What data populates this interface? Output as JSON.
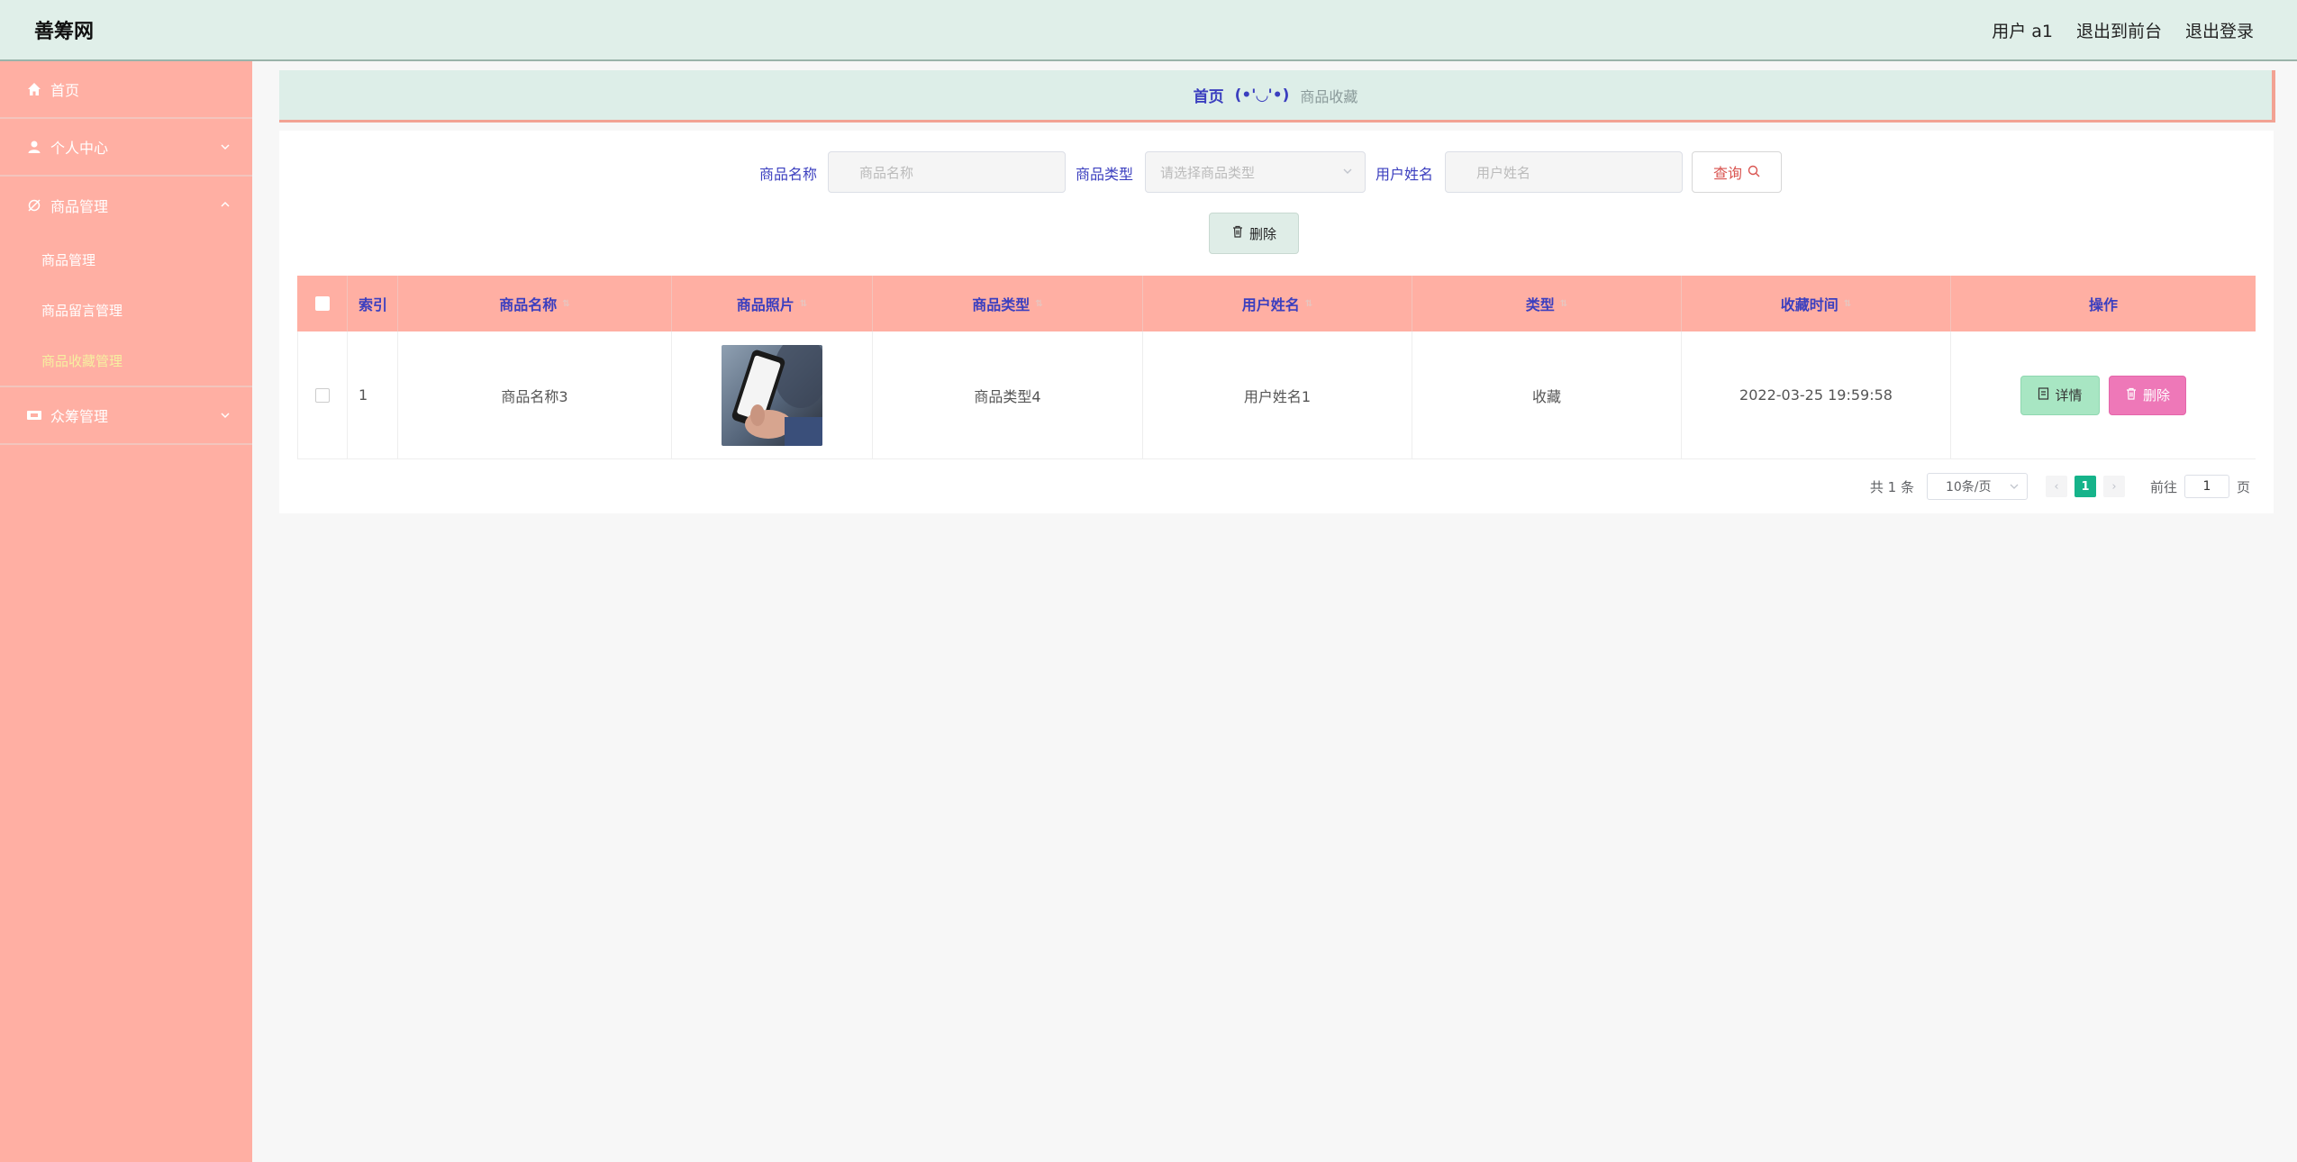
{
  "header": {
    "logo": "善筹网",
    "user_label": "用户 a1",
    "back_to_front": "退出到前台",
    "logout": "退出登录"
  },
  "sidebar": {
    "home": "首页",
    "personal_center": "个人中心",
    "goods_management": "商品管理",
    "sub_items": [
      "商品管理",
      "商品留言管理",
      "商品收藏管理"
    ],
    "crowdfunding_management": "众筹管理"
  },
  "breadcrumb": {
    "home": "首页",
    "emoticon": "(•'◡'•)",
    "current": "商品收藏"
  },
  "search": {
    "name_label": "商品名称",
    "name_placeholder": "商品名称",
    "type_label": "商品类型",
    "type_placeholder": "请选择商品类型",
    "user_label": "用户姓名",
    "user_placeholder": "用户姓名",
    "query_label": "查询"
  },
  "toolbar": {
    "delete_label": "删除"
  },
  "table": {
    "headers": [
      "索引",
      "商品名称",
      "商品照片",
      "商品类型",
      "用户姓名",
      "类型",
      "收藏时间",
      "操作"
    ],
    "rows": [
      {
        "index": "1",
        "name": "商品名称3",
        "type": "商品类型4",
        "user": "用户姓名1",
        "kind": "收藏",
        "time": "2022-03-25 19:59:58",
        "detail_label": "详情",
        "delete_label": "删除"
      }
    ]
  },
  "pagination": {
    "total": "共 1 条",
    "page_size": "10条/页",
    "current_page": "1",
    "goto_label": "前往",
    "goto_value": "1",
    "page_suffix": "页"
  }
}
